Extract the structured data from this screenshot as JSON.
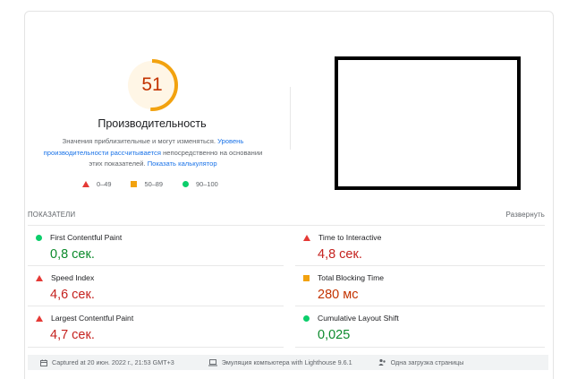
{
  "score": {
    "value": "51",
    "fraction": 0.51,
    "color": "#f2a20f",
    "title": "Производительность",
    "desc_text1": "Значения приблизительные и могут изменяться. ",
    "desc_link1": "Уровень производительности рассчитывается",
    "desc_text2": " непосредственно на основании этих показателей. ",
    "desc_link2": "Показать калькулятор"
  },
  "legend": [
    {
      "label": "0–49",
      "icon": "triangle-icon",
      "color": "#e53935"
    },
    {
      "label": "50–89",
      "icon": "square-icon",
      "color": "#f2a20f"
    },
    {
      "label": "90–100",
      "icon": "circle-icon",
      "color": "#0cce6b"
    }
  ],
  "metrics_section": {
    "title": "ПОКАЗАТЕЛИ",
    "expand_label": "Развернуть"
  },
  "metrics": [
    {
      "label": "First Contentful Paint",
      "value": "0,8 сек.",
      "status": "good",
      "icon": "circle-icon"
    },
    {
      "label": "Time to Interactive",
      "value": "4,8 сек.",
      "status": "poor",
      "icon": "triangle-icon"
    },
    {
      "label": "Speed Index",
      "value": "4,6 сек.",
      "status": "poor",
      "icon": "triangle-icon"
    },
    {
      "label": "Total Blocking Time",
      "value": "280 мс",
      "status": "average",
      "icon": "square-icon"
    },
    {
      "label": "Largest Contentful Paint",
      "value": "4,7 сек.",
      "status": "poor",
      "icon": "triangle-icon"
    },
    {
      "label": "Cumulative Layout Shift",
      "value": "0,025",
      "status": "good",
      "icon": "circle-icon"
    }
  ],
  "footer": {
    "captured": "Captured at 20 июн. 2022 г., 21:53 GMT+3",
    "emulation": "Эмуляция компьютера with Lighthouse 9.6.1",
    "load": "Одна загрузка страницы"
  }
}
